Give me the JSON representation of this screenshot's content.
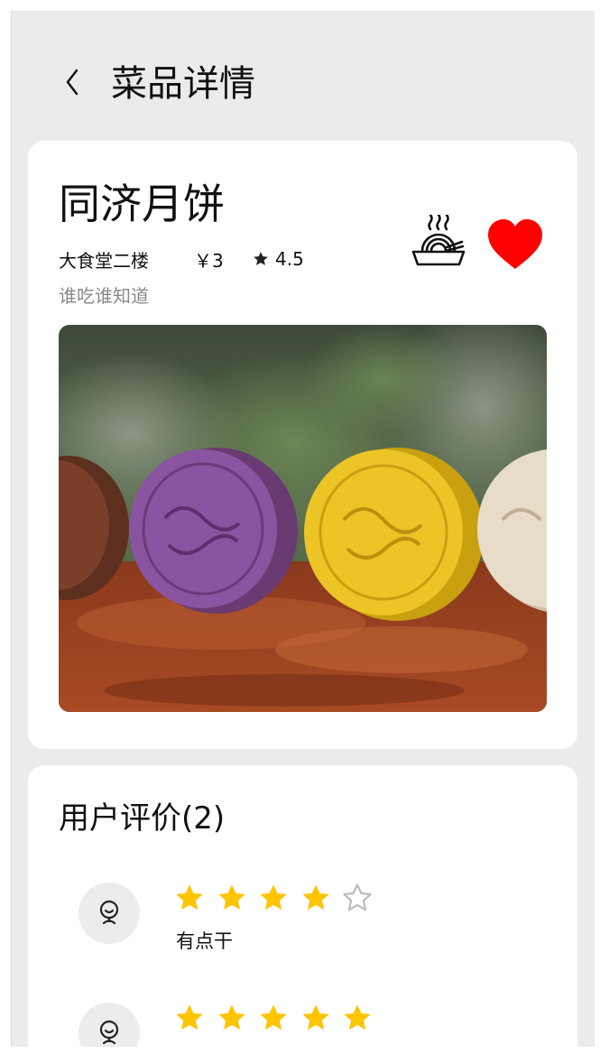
{
  "header": {
    "title": "菜品详情",
    "back_icon": "chevron-left-icon"
  },
  "dish": {
    "name": "同济月饼",
    "location": "大食堂二楼",
    "price": "￥3",
    "rating": "4.5",
    "description": "谁吃谁知道",
    "icons": [
      "noodle-bowl-icon",
      "heart-icon",
      "star-icon"
    ],
    "favorite": true,
    "favorite_color": "#ff0000",
    "photo_subject": "mooncakes"
  },
  "reviews": {
    "heading": "用户评价(2)",
    "star_color": "#ffc400",
    "empty_star_color": "#bdbdbd",
    "items": [
      {
        "stars": 4,
        "max_stars": 5,
        "text": "有点干"
      },
      {
        "stars": 5,
        "max_stars": 5,
        "text": ""
      }
    ]
  }
}
